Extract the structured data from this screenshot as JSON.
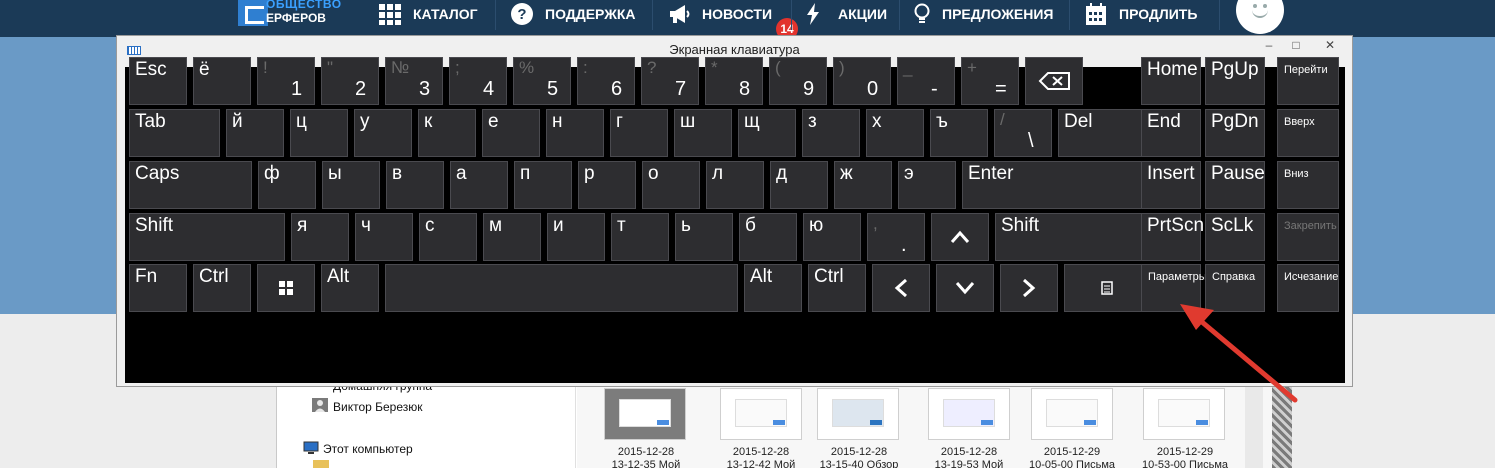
{
  "site": {
    "logo_line1": "ОБЩЕСТВО",
    "logo_line2": "ЕРФЕРОВ",
    "nav": [
      {
        "label": "КАТАЛОГ",
        "icon": "grid-icon"
      },
      {
        "label": "ПОДДЕРЖКА",
        "icon": "question-icon"
      },
      {
        "label": "НОВОСТИ",
        "icon": "megaphone-icon",
        "badge": "14"
      },
      {
        "label": "АКЦИИ",
        "icon": "lightning-icon"
      },
      {
        "label": "ПРЕДЛОЖЕНИЯ",
        "icon": "lightbulb-icon"
      },
      {
        "label": "ПРОДЛИТЬ",
        "icon": "calendar-icon"
      }
    ]
  },
  "osk": {
    "title": "Экранная клавиатура",
    "window_buttons": {
      "minimize": "–",
      "maximize": "□",
      "close": "✕"
    },
    "rows": [
      [
        {
          "primary": "Esc"
        },
        {
          "primary": "ё"
        },
        {
          "secondary": "!",
          "primary": "1"
        },
        {
          "secondary": "\"",
          "primary": "2"
        },
        {
          "secondary": "№",
          "primary": "3"
        },
        {
          "secondary": ";",
          "primary": "4"
        },
        {
          "secondary": "%",
          "primary": "5"
        },
        {
          "secondary": ":",
          "primary": "6"
        },
        {
          "secondary": "?",
          "primary": "7"
        },
        {
          "secondary": "*",
          "primary": "8"
        },
        {
          "secondary": "(",
          "primary": "9"
        },
        {
          "secondary": ")",
          "primary": "0"
        },
        {
          "secondary": "_",
          "primary": "-"
        },
        {
          "secondary": "+",
          "primary": "="
        },
        {
          "icon": "backspace-icon"
        }
      ],
      [
        {
          "primary": "Tab"
        },
        {
          "primary": "й"
        },
        {
          "primary": "ц"
        },
        {
          "primary": "у"
        },
        {
          "primary": "к"
        },
        {
          "primary": "е"
        },
        {
          "primary": "н"
        },
        {
          "primary": "г"
        },
        {
          "primary": "ш"
        },
        {
          "primary": "щ"
        },
        {
          "primary": "з"
        },
        {
          "primary": "х"
        },
        {
          "primary": "ъ"
        },
        {
          "secondary": "/",
          "primary": "\\"
        },
        {
          "primary": "Del"
        }
      ],
      [
        {
          "primary": "Caps"
        },
        {
          "primary": "ф"
        },
        {
          "primary": "ы"
        },
        {
          "primary": "в"
        },
        {
          "primary": "а"
        },
        {
          "primary": "п"
        },
        {
          "primary": "р"
        },
        {
          "primary": "о"
        },
        {
          "primary": "л"
        },
        {
          "primary": "д"
        },
        {
          "primary": "ж"
        },
        {
          "primary": "э"
        },
        {
          "primary": "Enter"
        }
      ],
      [
        {
          "primary": "Shift"
        },
        {
          "primary": "я"
        },
        {
          "primary": "ч"
        },
        {
          "primary": "с"
        },
        {
          "primary": "м"
        },
        {
          "primary": "и"
        },
        {
          "primary": "т"
        },
        {
          "primary": "ь"
        },
        {
          "primary": "б"
        },
        {
          "primary": "ю"
        },
        {
          "secondary": ",",
          "primary": "."
        },
        {
          "icon": "arrow-up-icon"
        },
        {
          "primary": "Shift"
        }
      ],
      [
        {
          "primary": "Fn"
        },
        {
          "primary": "Ctrl"
        },
        {
          "icon": "windows-icon"
        },
        {
          "primary": "Alt"
        },
        {
          "primary": ""
        },
        {
          "primary": "Alt"
        },
        {
          "primary": "Ctrl"
        },
        {
          "icon": "arrow-left-icon"
        },
        {
          "icon": "arrow-down-icon"
        },
        {
          "icon": "arrow-right-icon"
        },
        {
          "icon": "menu-icon"
        }
      ]
    ],
    "nav_keys": [
      [
        "Home",
        "PgUp"
      ],
      [
        "End",
        "PgDn"
      ],
      [
        "Insert",
        "Pause"
      ],
      [
        "PrtScn",
        "ScLk"
      ],
      [
        "Параметры",
        "Справка"
      ]
    ],
    "side_keys": [
      "Перейти",
      "Вверх",
      "Вниз",
      "Закрепить",
      "Исчезание"
    ]
  },
  "explorer": {
    "tree": [
      {
        "label": "Домашняя группа",
        "icon": "homegroup-icon"
      },
      {
        "label": "Виктор Березюк",
        "icon": "user-icon"
      },
      {
        "label": "Этот компьютер",
        "icon": "computer-icon"
      }
    ],
    "thumbnails": [
      {
        "line1": "2015-12-28",
        "line2": "13-12-35 Мой"
      },
      {
        "line1": "2015-12-28",
        "line2": "13-12-42 Мой"
      },
      {
        "line1": "2015-12-28",
        "line2": "13-15-40 Обзор"
      },
      {
        "line1": "2015-12-28",
        "line2": "13-19-53 Мой"
      },
      {
        "line1": "2015-12-29",
        "line2": "10-05-00 Письма"
      },
      {
        "line1": "2015-12-29",
        "line2": "10-53-00 Письма"
      }
    ]
  },
  "colors": {
    "topbar": "#1b3a57",
    "band": "#6a9ac6",
    "key_bg": "#2d2d30",
    "badge": "#e2332d",
    "arrow": "#e03a2f"
  }
}
